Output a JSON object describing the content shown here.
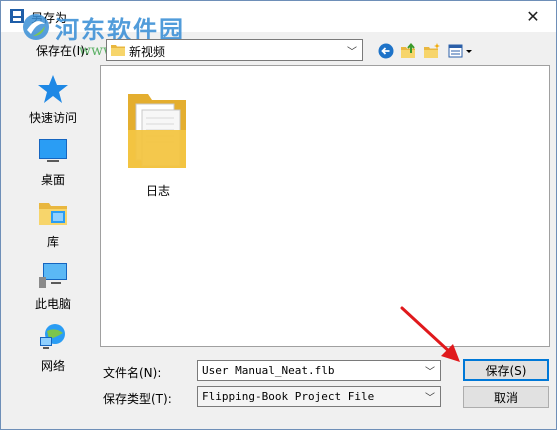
{
  "window": {
    "title": "另存为",
    "close_glyph": "✕"
  },
  "watermark": {
    "title": "河东软件园",
    "url": "www.pc0359.cn"
  },
  "location": {
    "label": "保存在(I):",
    "value": "新视频"
  },
  "toolbar": {
    "icons": [
      "back-icon",
      "up-folder-icon",
      "new-folder-icon",
      "view-menu-icon"
    ]
  },
  "places": [
    {
      "label": "快速访问",
      "icon": "star-icon"
    },
    {
      "label": "桌面",
      "icon": "desktop-icon"
    },
    {
      "label": "库",
      "icon": "library-icon"
    },
    {
      "label": "此电脑",
      "icon": "computer-icon"
    },
    {
      "label": "网络",
      "icon": "network-icon"
    }
  ],
  "files": [
    {
      "name": "日志",
      "type": "folder"
    }
  ],
  "filename": {
    "label": "文件名(N):",
    "value": "User Manual_Neat.flb"
  },
  "filetype": {
    "label": "保存类型(T):",
    "value": "Flipping-Book Project File"
  },
  "buttons": {
    "save": "保存(S)",
    "cancel": "取消"
  },
  "colors": {
    "accent": "#0078d7",
    "arrow": "#e0191c",
    "folder": "#f3c542",
    "watermark_title": "#3a8fd6",
    "watermark_url": "#4aaa55"
  }
}
